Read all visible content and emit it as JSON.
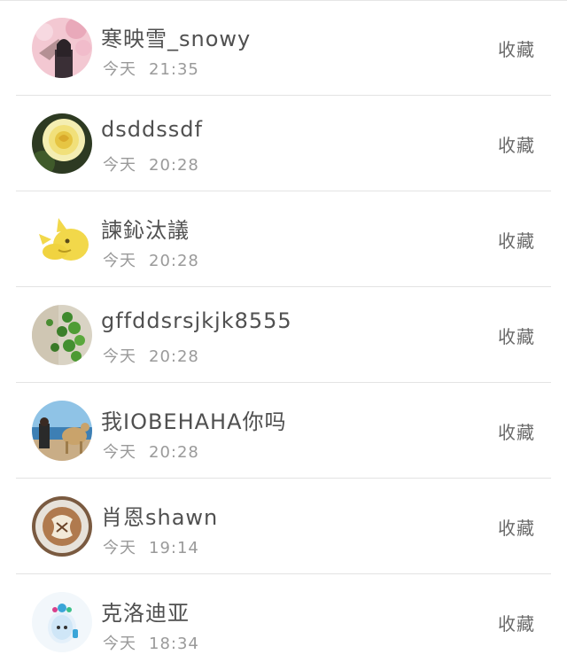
{
  "collect_label": "收藏",
  "rows": [
    {
      "name": "寒映雪_snowy",
      "day": "今天",
      "time": "21:35",
      "avatar": "cherry-blossom-girl-avatar"
    },
    {
      "name": "dsddssdf",
      "day": "今天",
      "time": "20:28",
      "avatar": "yellow-rose-avatar"
    },
    {
      "name": "諫鈊汰議",
      "day": "今天",
      "time": "20:28",
      "avatar": "yellow-cartoon-avatar"
    },
    {
      "name": "gffddsrsjkjk8555",
      "day": "今天",
      "time": "20:28",
      "avatar": "green-leaves-avatar"
    },
    {
      "name": "我IOBEHAHA你吗",
      "day": "今天",
      "time": "20:28",
      "avatar": "beach-camels-avatar"
    },
    {
      "name": "肖恩shawn",
      "day": "今天",
      "time": "19:14",
      "avatar": "latte-art-avatar"
    },
    {
      "name": "克洛迪亚",
      "day": "今天",
      "time": "18:34",
      "avatar": "blue-cartoon-avatar"
    }
  ]
}
